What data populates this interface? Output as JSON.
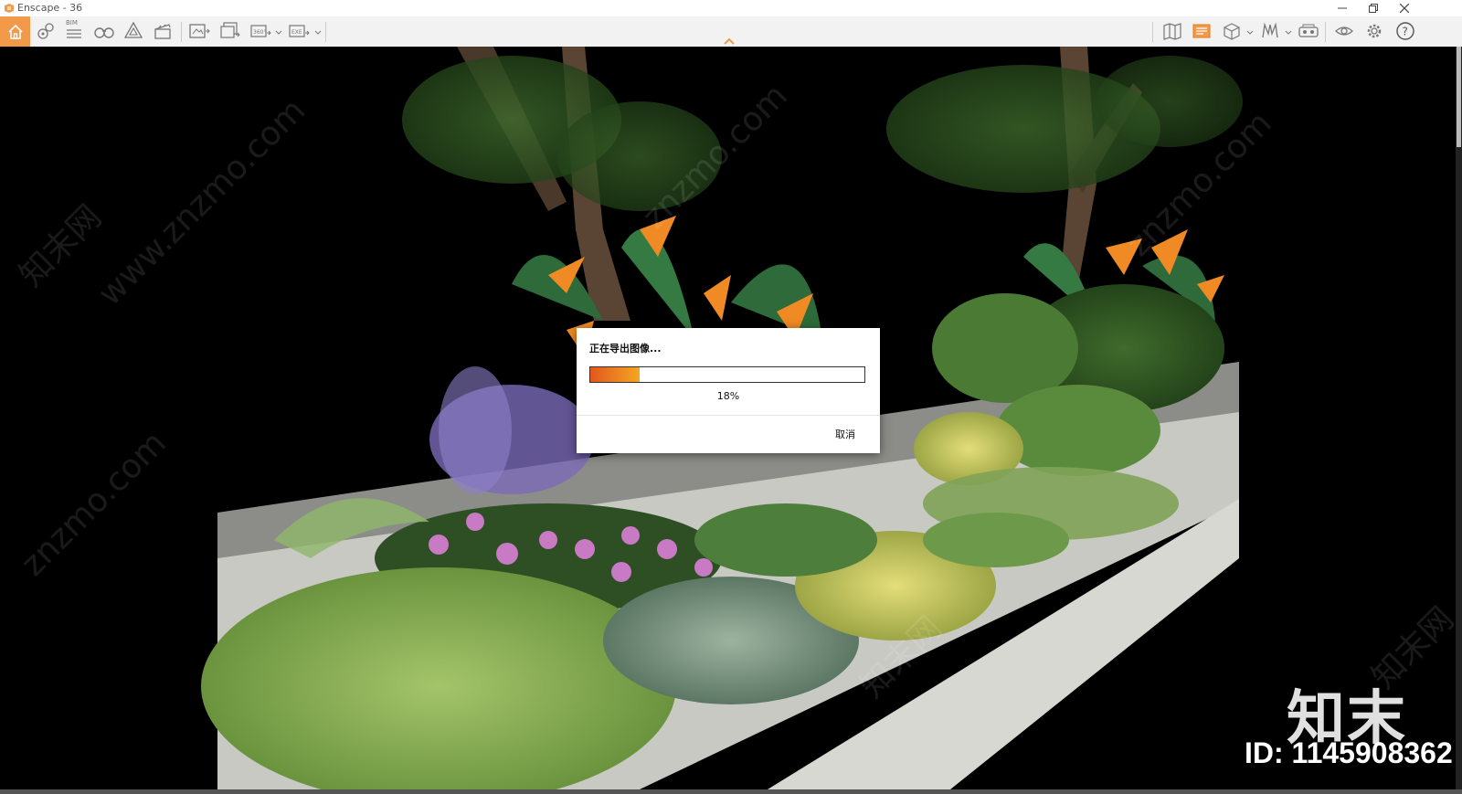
{
  "window": {
    "title": "Enscape - 36"
  },
  "toolbar": {
    "left_tools": [
      "home-icon",
      "view-management-icon",
      "bim-icon",
      "binoculars-icon",
      "asset-library-icon",
      "clapperboard-icon",
      "screenshot-icon",
      "batch-render-icon",
      "panorama-export-icon",
      "exe-export-icon"
    ],
    "bim_label": "BIM",
    "right_tools": [
      "map-icon",
      "visual-settings-icon",
      "cube-view-icon",
      "atlas-icon",
      "vr-headset-icon",
      "eye-icon",
      "gear-icon",
      "help-icon"
    ]
  },
  "dialog": {
    "title": "正在导出图像...",
    "progress": 18,
    "progress_text": "18%",
    "cancel_label": "取消"
  },
  "watermark": {
    "brand": "知末",
    "id": "ID: 1145908362",
    "site": "www.znzmo.com",
    "site_short": "znzmo.com",
    "cn": "知末网"
  },
  "colors": {
    "accent": "#f2994a",
    "progress_start": "#e2571d",
    "progress_end": "#f5a623"
  }
}
